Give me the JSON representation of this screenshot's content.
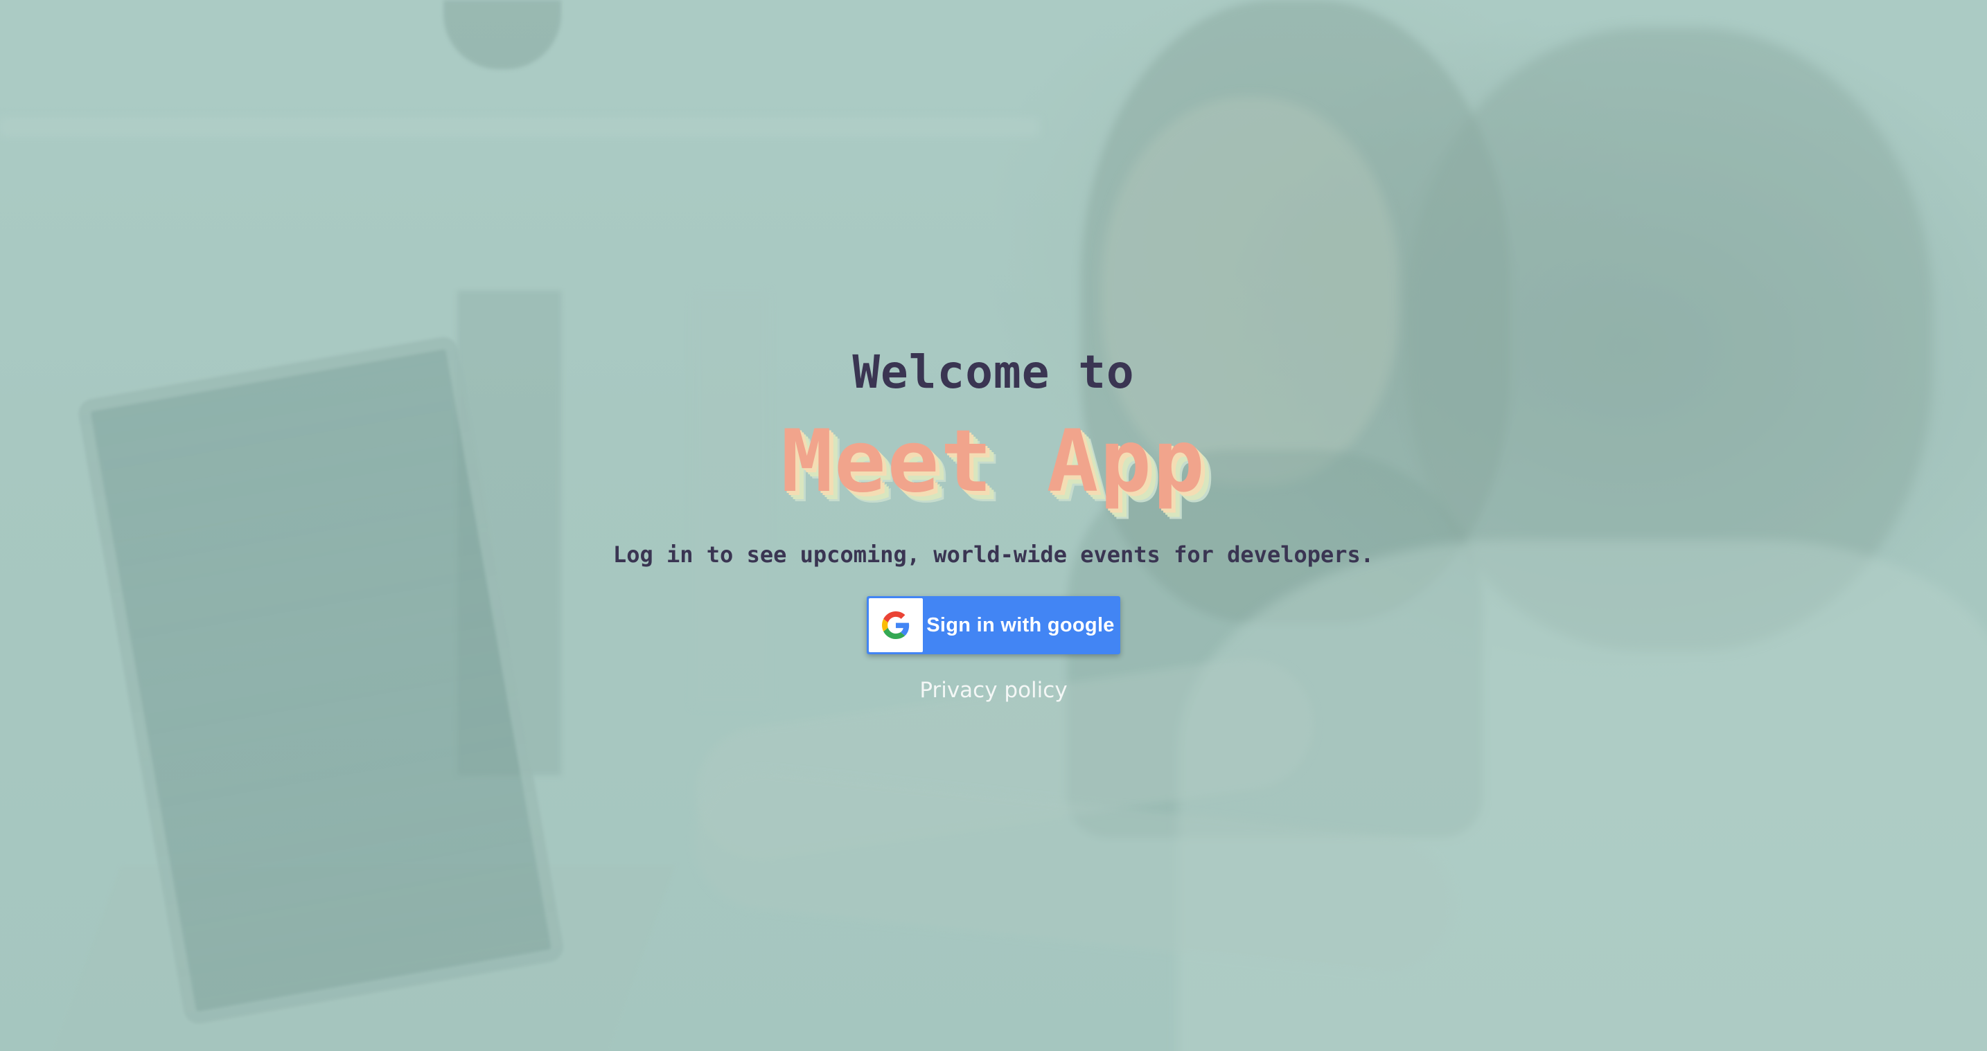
{
  "background": {
    "image_subject": "two-people-at-laptop-photo",
    "tint_color": "#a9c6c0"
  },
  "hero": {
    "welcome_text": "Welcome to",
    "app_name": "Meet App",
    "tagline": "Log in to see upcoming, world-wide events for developers."
  },
  "signin": {
    "label": "Sign in with google",
    "icon": "google-g-icon",
    "button_color": "#4285f4"
  },
  "footer": {
    "privacy_link": "Privacy policy"
  },
  "colors": {
    "title_text": "#3a3552",
    "app_name": "#f1a48c",
    "shadow_yellow": "#f4ddb4",
    "shadow_green": "#d9e6bf"
  }
}
